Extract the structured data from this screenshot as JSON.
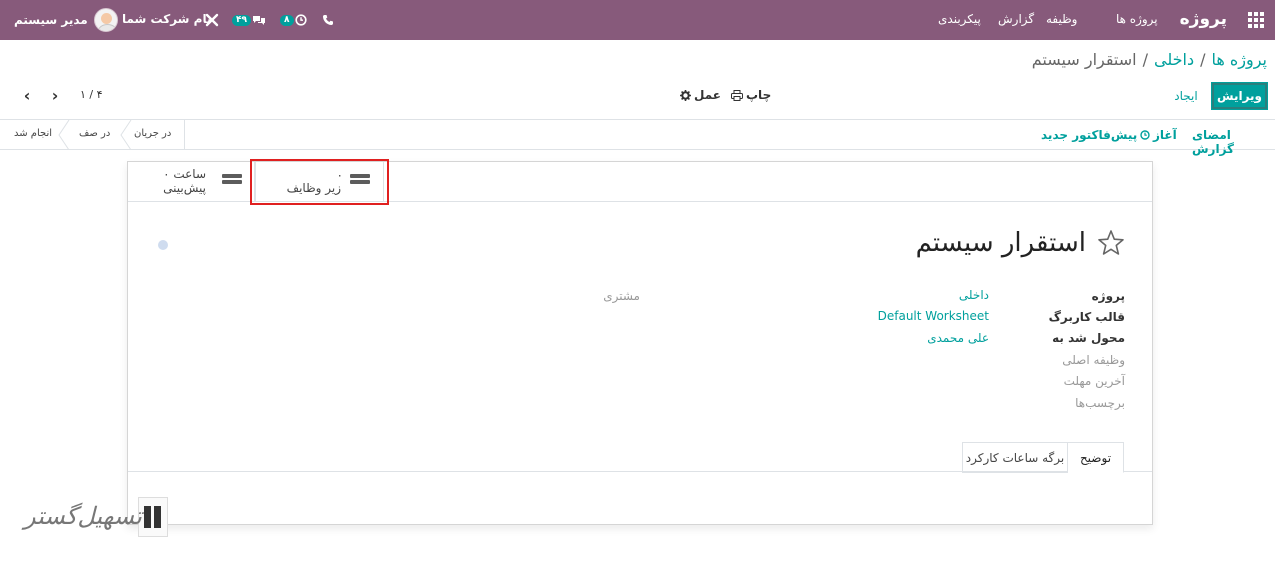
{
  "navbar": {
    "brand": "پروژه",
    "menu": [
      "پروژه ها",
      "وظیفه",
      "گزارش",
      "پیکربندی"
    ],
    "activity_badge": "۸",
    "messages_badge": "۴۹",
    "company": "نام شرکت شما",
    "user": "مدیر سیستم"
  },
  "breadcrumb": {
    "items": [
      "پروژه ها",
      "داخلی"
    ],
    "separator": "/",
    "current": "استقرار سیستم"
  },
  "controls": {
    "edit_label": "ویرایش",
    "create_label": "ایجاد",
    "print_label": "چاپ",
    "action_label": "عمل",
    "pager": "۱ / ۴"
  },
  "statusbar": {
    "buttons": [
      "امضای گزارش",
      "آغاز",
      "پیش‌فاکتور جدید"
    ],
    "stages": [
      "در جریان",
      "در صف",
      "انجام شد"
    ]
  },
  "smart_buttons": {
    "subtasks_count": "۰",
    "subtasks_label": "زیر وظایف",
    "planned_value": "۰ ساعت",
    "planned_label": "پیش‌بینی"
  },
  "record": {
    "title": "استقرار سیستم",
    "fields": {
      "project_label": "پروژه",
      "project_value": "داخلی",
      "worksheet_label": "قالب کاربرگ",
      "worksheet_value": "Default Worksheet",
      "assigned_label": "محول شد به",
      "assigned_value": "علی محمدی",
      "parent_label": "وظیفه اصلی",
      "deadline_label": "آخرین مهلت",
      "tags_label": "برچسب‌ها",
      "customer_label": "مشتری"
    }
  },
  "tabs": {
    "description": "توضیح",
    "timesheet": "برگه ساعات کارکرد"
  },
  "watermark": {
    "text": "تسهیل‌گستر"
  },
  "colors": {
    "navbar": "#875a7b",
    "accent": "#00A09D",
    "highlight": "#e02020"
  }
}
